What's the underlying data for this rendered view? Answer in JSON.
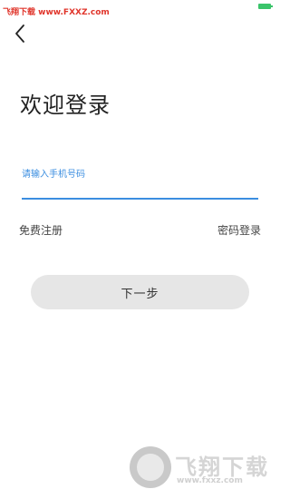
{
  "watermark": {
    "top_text": "飞翔下载 www.FXXZ.com",
    "bottom_text": "飞翔下载",
    "bottom_sub": "www.fxxz.com"
  },
  "header": {
    "back_icon": "chevron-left-icon"
  },
  "title": "欢迎登录",
  "phone": {
    "label": "请输入手机号码",
    "value": ""
  },
  "links": {
    "register": "免费注册",
    "password_login": "密码登录"
  },
  "next_button": "下一步",
  "colors": {
    "accent": "#3b8ee0",
    "button_bg": "#e6e6e6",
    "watermark_red": "#e0352b"
  }
}
